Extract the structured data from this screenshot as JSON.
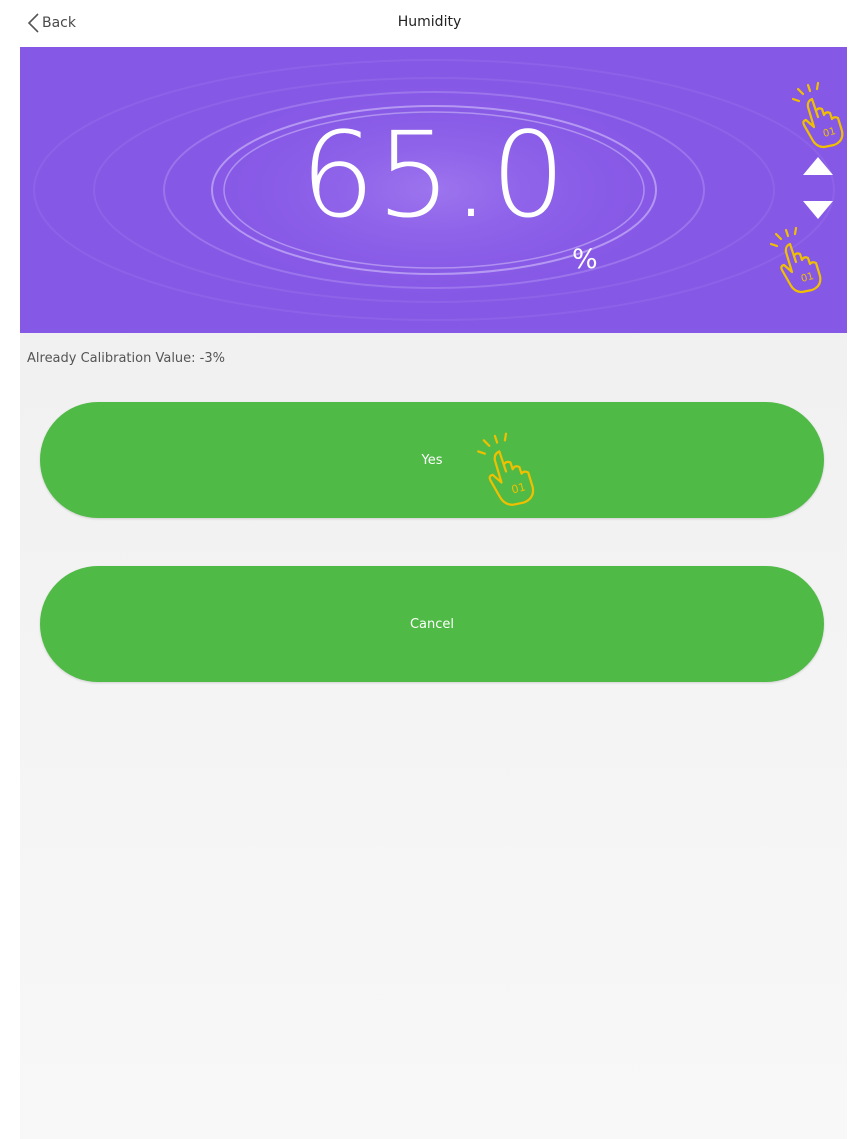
{
  "nav": {
    "back_label": "Back",
    "title": "Humidity",
    "back_icon": "chevron-left-icon"
  },
  "reading": {
    "value": "65.0",
    "unit": "%",
    "increase_icon": "triangle-up-icon",
    "decrease_icon": "triangle-down-icon"
  },
  "calibration": {
    "text": "Already Calibration Value:  -3%"
  },
  "actions": {
    "yes_label": "Yes",
    "cancel_label": "Cancel"
  },
  "colors": {
    "banner": "#8658e6",
    "button": "#4fba45",
    "hint_hand": "#f0c000"
  }
}
